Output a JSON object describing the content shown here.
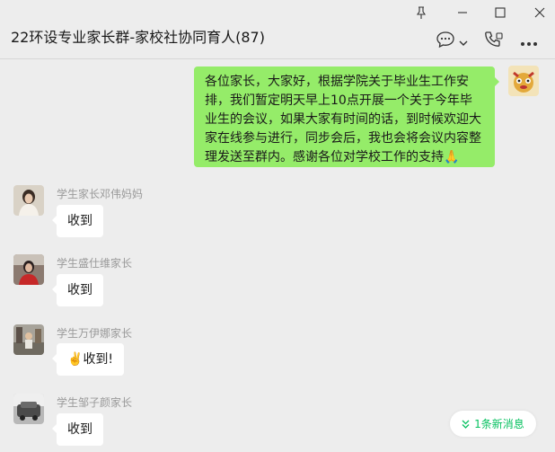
{
  "window": {
    "pin_icon": "pin-icon",
    "minimize_icon": "minimize-icon",
    "maximize_icon": "maximize-icon",
    "close_icon": "close-icon"
  },
  "header": {
    "title": "22环设专业家长群-家校社协同育人(87)",
    "chat_icon": "chat-bubble-icon",
    "call_icon": "phone-icon",
    "more_icon": "more-icon"
  },
  "messages": {
    "mine": {
      "text": "各位家长，大家好，根据学院关于毕业生工作安排，我们暂定明天早上10点开展一个关于今年毕业生的会议，如果大家有时间的话，到时候欢迎大家在线参与进行，同步会后，我也会将会议内容整理发送至群内。感谢各位对学校工作的支持🙏"
    },
    "m1": {
      "sender": "学生家长邓伟妈妈",
      "text": "收到"
    },
    "m2": {
      "sender": "学生盛仕维家长",
      "text": "收到"
    },
    "m3": {
      "sender": "学生万伊娜家长",
      "emoji": "✌️",
      "text": "收到!"
    },
    "m4": {
      "sender": "学生邹子颜家长",
      "text": "收到"
    }
  },
  "new_message": {
    "label": "1条新消息",
    "icon": "double-chevron-down-icon"
  },
  "colors": {
    "mine_bubble": "#95ec69",
    "accent": "#07c160",
    "background": "#ededed"
  }
}
